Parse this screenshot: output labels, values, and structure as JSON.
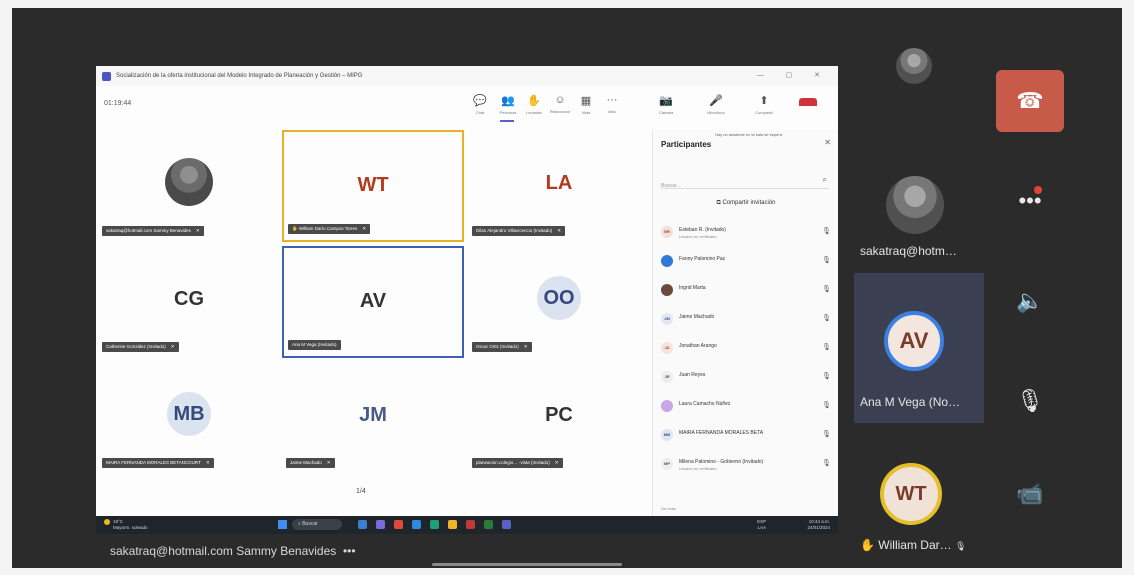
{
  "window": {
    "title": "Socialización de la oferta institucional del Modelo Integrado de Planeación y Gestión – MIPG",
    "controls": "— ▢ ✕",
    "timer": "01:19:44"
  },
  "toolbar": {
    "buttons": [
      {
        "label": "Chat",
        "icon": "💬"
      },
      {
        "label": "Personas",
        "icon": "👥"
      },
      {
        "label": "Levantar",
        "icon": "✋"
      },
      {
        "label": "Reaccionar",
        "icon": "☺"
      },
      {
        "label": "Vista",
        "icon": "▦"
      },
      {
        "label": "Más",
        "icon": "···"
      },
      {
        "label": "Cámara",
        "icon": "📷"
      },
      {
        "label": "Micrófono",
        "icon": "🎤"
      },
      {
        "label": "Compartir",
        "icon": "⬆"
      }
    ]
  },
  "grid": {
    "tiles": [
      {
        "initials": "",
        "photo": true,
        "name": "sakatraq@hotmail.com Sammy Benavides"
      },
      {
        "initials": "WT",
        "name": "William Darío Campos Torres"
      },
      {
        "initials": "LA",
        "name": "Dilan Alejandro Villavicencio (Invitado)"
      },
      {
        "initials": "CG",
        "name": "Catherine González (Invitado)"
      },
      {
        "initials": "AV",
        "name": "Ana M Vega (Invitado)"
      },
      {
        "initials": "OO",
        "name": "Oscar Ortiz (Invitado)"
      },
      {
        "initials": "MB",
        "name": "MAIRA FERNANDA MORALES BETANCOURT"
      },
      {
        "initials": "JM",
        "name": "Jaime Machado"
      },
      {
        "initials": "PC",
        "name": "planeacion.colegio… -vista (Invitado)"
      }
    ],
    "pager": "1/4"
  },
  "panel": {
    "title": "Participantes",
    "note": "Hay un asistente en la sala de espera",
    "search_placeholder": "Buscar…",
    "invite_label": "Compartir invitación",
    "participants": [
      {
        "initials": "ER",
        "name": "Esteban R. (Invitado)",
        "sub": "Usuario no verificado",
        "bg": "#f3e0dc",
        "fg": "#a3352b"
      },
      {
        "initials": "",
        "name": "Fanny Palomino Paz",
        "sub": "",
        "bg": "#2f7ad8",
        "fg": "#ffffff"
      },
      {
        "initials": "",
        "name": "Ingrid Marta",
        "sub": "",
        "bg": "#6b4a3a",
        "fg": "#ffffff"
      },
      {
        "initials": "JM",
        "name": "Jaime Machado",
        "sub": "",
        "bg": "#e3e8f4",
        "fg": "#3a4f85"
      },
      {
        "initials": "JA",
        "name": "Jonathan Arango",
        "sub": "",
        "bg": "#f4e2dd",
        "fg": "#b34a2a"
      },
      {
        "initials": "JR",
        "name": "Juan Reyes",
        "sub": "",
        "bg": "#eeeeee",
        "fg": "#555555"
      },
      {
        "initials": "",
        "name": "Laura Camacho Núñez",
        "sub": "",
        "bg": "#c9a7e6",
        "fg": "#ffffff"
      },
      {
        "initials": "MB",
        "name": "MAIRA FERNANDA MORALES BETA",
        "sub": "",
        "bg": "#dde6f4",
        "fg": "#3a4f85"
      },
      {
        "initials": "MP",
        "name": "Milena Palomino - Gobierno (Invitado)",
        "sub": "Usuario no verificado",
        "bg": "#eeeeee",
        "fg": "#555555"
      }
    ],
    "footer": "Ver más"
  },
  "taskbar": {
    "weather_temp": "19°C",
    "weather_text": "Mayorm. soleado",
    "search": "Buscar",
    "lang": "ESP LAA",
    "time": "10:44 a.m.",
    "date": "24/01/2024"
  },
  "side": {
    "top_name": "sakatraq@hotm…",
    "av_initials": "AV",
    "av_name": "Ana M Vega (No…",
    "wt_initials": "WT",
    "wt_name": "William Dar…"
  },
  "bottom": {
    "caption": "sakatraq@hotmail.com Sammy Benavides",
    "more": "•••"
  }
}
